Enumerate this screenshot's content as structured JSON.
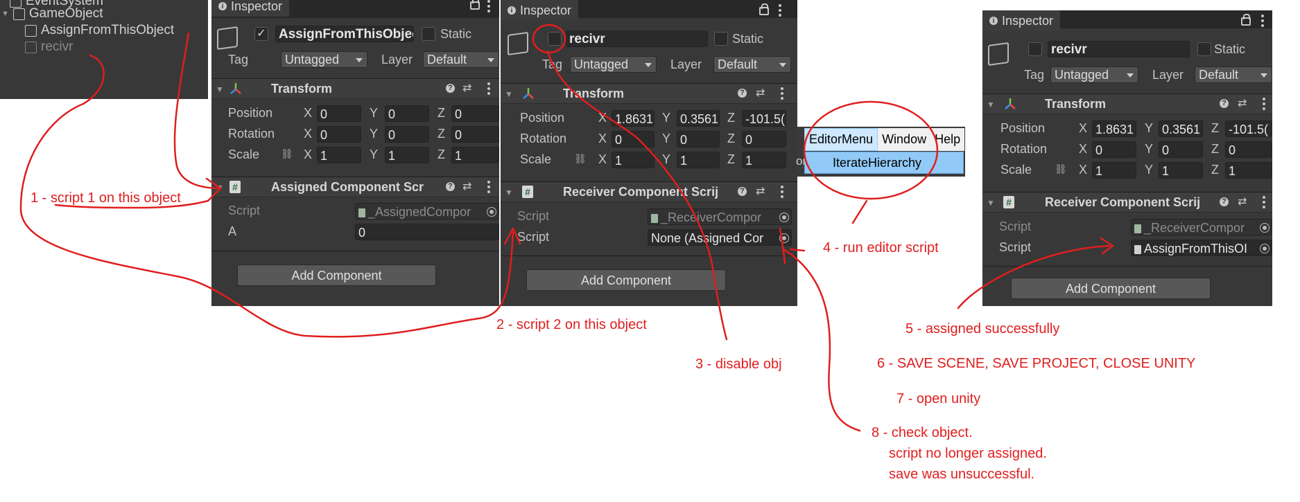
{
  "hierarchy": {
    "items": [
      {
        "label": "EventSystem"
      },
      {
        "label": "GameObject"
      },
      {
        "label": "AssignFromThisObject"
      },
      {
        "label": "recivr"
      }
    ]
  },
  "inspector1": {
    "tab": "Inspector",
    "object_name": "AssignFromThisObject",
    "static_label": "Static",
    "tag_label": "Tag",
    "tag_value": "Untagged",
    "layer_label": "Layer",
    "layer_value": "Default",
    "transform_title": "Transform",
    "position_label": "Position",
    "rotation_label": "Rotation",
    "scale_label": "Scale",
    "position": {
      "x": "0",
      "y": "0",
      "z": "0"
    },
    "rotation": {
      "x": "0",
      "y": "0",
      "z": "0"
    },
    "scale": {
      "x": "1",
      "y": "1",
      "z": "1"
    },
    "component_title": "Assigned Component Scr",
    "script_label": "Script",
    "script_value": "_AssignedCompor",
    "a_label": "A",
    "a_value": "0",
    "add_component": "Add Component"
  },
  "inspector2": {
    "tab": "Inspector",
    "object_name": "recivr",
    "static_label": "Static",
    "tag_label": "Tag",
    "tag_value": "Untagged",
    "layer_label": "Layer",
    "layer_value": "Default",
    "transform_title": "Transform",
    "position_label": "Position",
    "rotation_label": "Rotation",
    "scale_label": "Scale",
    "position": {
      "x": "1.8631",
      "y": "0.3561",
      "z": "-101.5("
    },
    "rotation": {
      "x": "0",
      "y": "0",
      "z": "0"
    },
    "scale": {
      "x": "1",
      "y": "1",
      "z": "1"
    },
    "component_title": "Receiver Component Scrij",
    "script_label": "Script",
    "script_value": "_ReceiverCompor",
    "script2_label": "Script",
    "script2_value": "None (Assigned Cor",
    "add_component": "Add Component"
  },
  "inspector3": {
    "tab": "Inspector",
    "object_name": "recivr",
    "static_label": "Static",
    "tag_label": "Tag",
    "tag_value": "Untagged",
    "layer_label": "Layer",
    "layer_value": "Default",
    "transform_title": "Transform",
    "position_label": "Position",
    "rotation_label": "Rotation",
    "scale_label": "Scale",
    "position": {
      "x": "1.8631",
      "y": "0.3561",
      "z": "-101.5("
    },
    "rotation": {
      "x": "0",
      "y": "0",
      "z": "0"
    },
    "scale": {
      "x": "1",
      "y": "1",
      "z": "1"
    },
    "component_title": "Receiver Component Scrij",
    "script_label": "Script",
    "script_value": "_ReceiverCompor",
    "script2_label": "Script",
    "script2_value": "AssignFromThisOI",
    "add_component": "Add Component"
  },
  "menu": {
    "items": [
      "EditorMenu",
      "Window",
      "Help"
    ],
    "dropdown_item": "IterateHierarchy",
    "cut_text": "or"
  },
  "axes": {
    "x": "X",
    "y": "Y",
    "z": "Z"
  },
  "annotations": {
    "n1": "1 - script 1 on this object",
    "n2": "2 - script 2 on this object",
    "n3": "3 - disable obj",
    "n4": "4 - run editor script",
    "n5": "5 - assigned successfully",
    "n6": "6 - SAVE SCENE, SAVE PROJECT, CLOSE UNITY",
    "n7": "7 - open unity",
    "n8a": "8 - check object.",
    "n8b": "script no longer assigned.",
    "n8c": "save was unsuccessful."
  },
  "colors": {
    "ink": "#e01e1e",
    "panel": "#383838"
  }
}
